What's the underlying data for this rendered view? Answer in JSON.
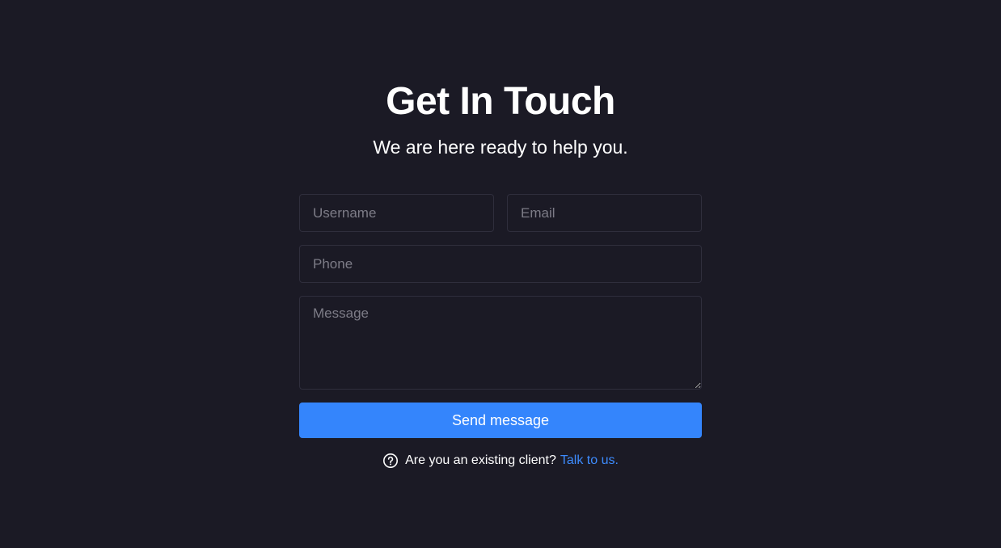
{
  "header": {
    "title": "Get In Touch",
    "subtitle": "We are here ready to help you."
  },
  "form": {
    "username_placeholder": "Username",
    "email_placeholder": "Email",
    "phone_placeholder": "Phone",
    "message_placeholder": "Message",
    "submit_label": "Send message"
  },
  "footer": {
    "icon": "question-circle-icon",
    "prompt": "Are you an existing client?",
    "link_label": "Talk to us."
  },
  "colors": {
    "background": "#1b1a25",
    "accent": "#3485fc",
    "link": "#3d8bfd",
    "field_border": "#2f2e3c"
  }
}
